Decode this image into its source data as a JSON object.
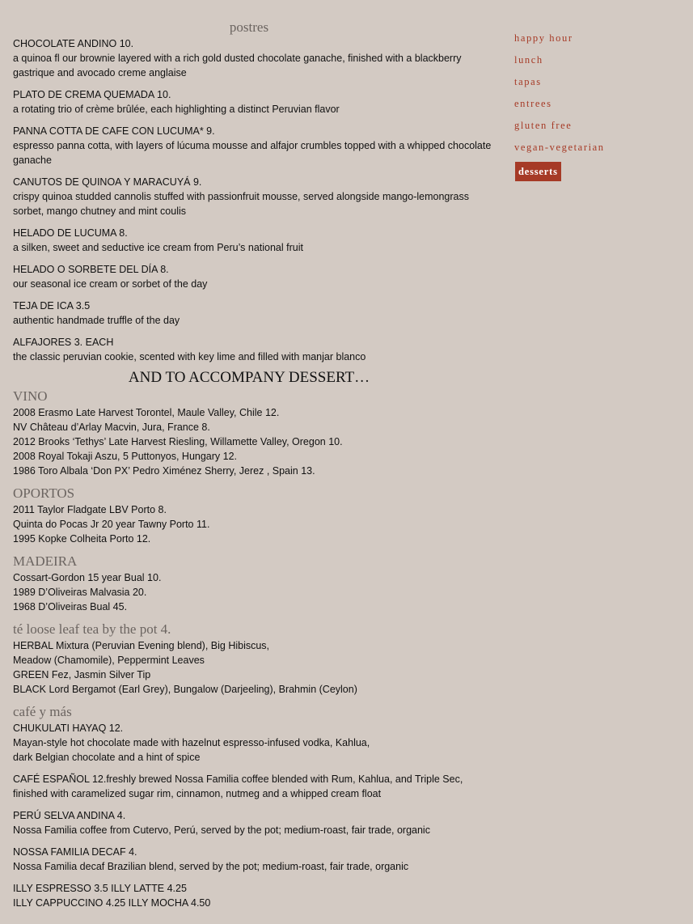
{
  "nav": {
    "items": [
      "happy hour",
      "lunch",
      "tapas",
      "entrees",
      "gluten free",
      "vegan-vegetarian"
    ],
    "active": "desserts",
    "accent_color": "#a63a26"
  },
  "postres": {
    "title": "postres",
    "items": [
      {
        "name": "CHOCOLATE ANDINO 10.",
        "desc": "a quinoa fl our brownie layered with a rich gold dusted chocolate ganache, finished with a blackberry gastrique and avocado creme anglaise"
      },
      {
        "name": "PLATO DE CREMA QUEMADA 10.",
        "desc": "a rotating trio of crème brûlée, each highlighting a distinct Peruvian flavor"
      },
      {
        "name": "PANNA COTTA DE CAFE CON LUCUMA* 9.",
        "desc": "espresso panna cotta, with layers of lúcuma mousse and alfajor crumbles topped with a whipped chocolate ganache"
      },
      {
        "name": "CANUTOS DE QUINOA Y MARACUYÁ 9.",
        "desc": "crispy quinoa studded cannolis stuffed with passionfruit mousse, served alongside mango-lemongrass sorbet, mango chutney and mint coulis"
      },
      {
        "name": "HELADO DE LUCUMA 8.",
        "desc": "a silken, sweet and seductive ice cream from Peru’s national fruit"
      },
      {
        "name": "HELADO O SORBETE DEL DÍA 8.",
        "desc": "our seasonal ice cream or sorbet of the day"
      },
      {
        "name": "TEJA DE ICA 3.5",
        "desc": "authentic handmade truffle of the day"
      },
      {
        "name": "ALFAJORES 3. EACH",
        "desc": "the classic peruvian cookie, scented with key lime and filled with manjar blanco"
      }
    ]
  },
  "accompany": "AND TO ACCOMPANY DESSERT…",
  "vino": {
    "title": "VINO",
    "lines": [
      "2008 Erasmo Late Harvest Torontel, Maule Valley, Chile 12.",
      "NV Château d’Arlay Macvin, Jura, France 8.",
      "2012 Brooks ‘Tethys’ Late Harvest Riesling, Willamette Valley, Oregon 10.",
      "2008 Royal Tokaji Aszu, 5 Puttonyos, Hungary 12.",
      "1986 Toro Albala ‘Don PX’ Pedro Ximénez Sherry, Jerez , Spain 13."
    ]
  },
  "oportos": {
    "title": "OPORTOS",
    "lines": [
      "2011 Taylor Fladgate LBV Porto 8.",
      "Quinta do Pocas Jr 20 year Tawny Porto 11.",
      "1995 Kopke Colheita Porto 12."
    ]
  },
  "madeira": {
    "title": "MADEIRA",
    "lines": [
      "Cossart-Gordon 15 year Bual 10.",
      "1989 D’Oliveiras Malvasia 20.",
      "1968 D’Oliveiras Bual 45."
    ]
  },
  "tea": {
    "title": "té loose leaf tea by the pot 4.",
    "lines": [
      "HERBAL Mixtura (Peruvian Evening blend), Big Hibiscus,",
      "Meadow (Chamomile), Peppermint Leaves",
      "GREEN Fez, Jasmin Silver Tip",
      "BLACK Lord Bergamot (Earl Grey), Bungalow (Darjeeling), Brahmin (Ceylon)"
    ]
  },
  "cafe": {
    "title": "café y más",
    "items": [
      {
        "name": "CHUKULATI HAYAQ 12.",
        "desc": "Mayan-style hot chocolate made with hazelnut espresso-infused vodka, Kahlua,\ndark Belgian chocolate and a hint of spice"
      },
      {
        "name": "CAFÉ ESPAÑOL 12.freshly brewed Nossa Familia coffee blended with Rum, Kahlua, and Triple Sec,",
        "desc": "finished with caramelized sugar rim, cinnamon, nutmeg and a whipped cream float"
      },
      {
        "name": "PERÚ SELVA ANDINA 4.",
        "desc": "Nossa Familia coffee from Cutervo, Perú, served by the pot; medium-roast, fair trade, organic"
      },
      {
        "name": "NOSSA FAMILIA DECAF 4.",
        "desc": "Nossa Familia decaf Brazilian blend, served by the pot; medium-roast, fair trade, organic"
      },
      {
        "name": "ILLY ESPRESSO 3.5 ILLY LATTE 4.25",
        "desc": "ILLY CAPPUCCINO 4.25 ILLY MOCHA 4.50"
      }
    ]
  }
}
